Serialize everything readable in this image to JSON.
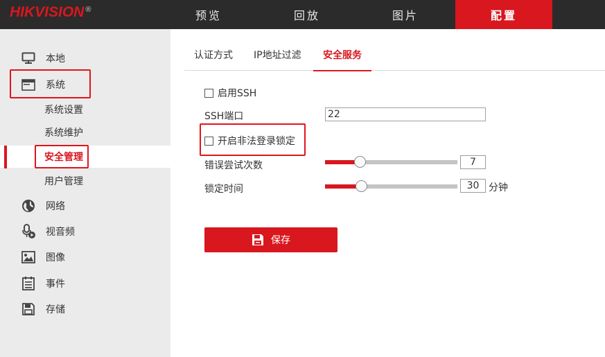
{
  "header": {
    "logo_text": "HIKVISION",
    "logo_mark": "®",
    "nav": [
      {
        "label": "预览"
      },
      {
        "label": "回放"
      },
      {
        "label": "图片"
      },
      {
        "label": "配置",
        "active": true
      }
    ]
  },
  "sidebar": {
    "items": [
      {
        "label": "本地",
        "icon": "monitor-icon"
      },
      {
        "label": "系统",
        "icon": "window-icon"
      },
      {
        "label": "网络",
        "icon": "globe-icon"
      },
      {
        "label": "视音频",
        "icon": "microphone-icon"
      },
      {
        "label": "图像",
        "icon": "image-icon"
      },
      {
        "label": "事件",
        "icon": "list-icon"
      },
      {
        "label": "存储",
        "icon": "floppy-icon"
      }
    ],
    "system_sub": [
      {
        "label": "系统设置"
      },
      {
        "label": "系统维护"
      },
      {
        "label": "安全管理",
        "active": true
      },
      {
        "label": "用户管理"
      }
    ]
  },
  "tabs": [
    {
      "label": "认证方式"
    },
    {
      "label": "IP地址过滤"
    },
    {
      "label": "安全服务",
      "active": true
    }
  ],
  "form": {
    "enable_ssh_label": "启用SSH",
    "enable_ssh_checked": false,
    "ssh_port_label": "SSH端口",
    "ssh_port_value": "22",
    "illegal_login_lock_label": "开启非法登录锁定",
    "illegal_login_lock_checked": false,
    "retry_label": "错误尝试次数",
    "retry_value": "7",
    "retry_fraction": 0.26,
    "lock_time_label": "锁定时间",
    "lock_time_value": "30",
    "lock_time_fraction": 0.27,
    "lock_time_unit": "分钟",
    "save_label": "保存"
  },
  "colors": {
    "accent": "#d9171e",
    "topbar": "#2b2b2b",
    "sidebar": "#ebebeb",
    "highlight_box": "#e0141b"
  }
}
